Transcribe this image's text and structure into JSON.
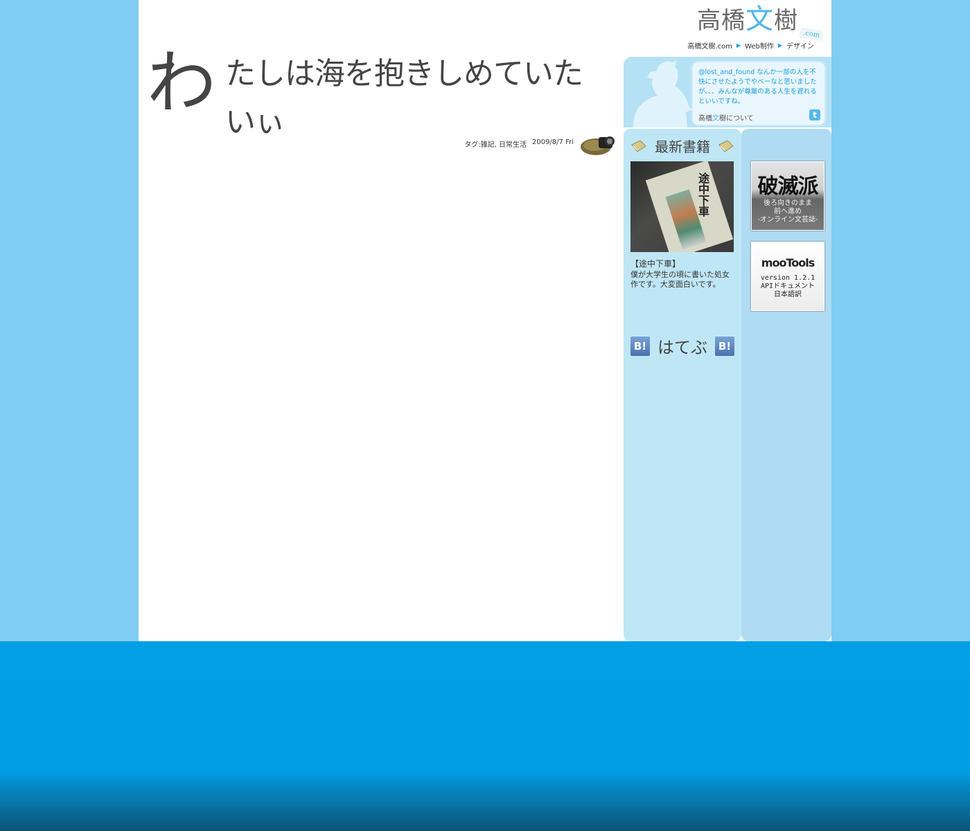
{
  "header": {
    "logo_left": "高橋",
    "logo_accent": "文",
    "logo_right": "樹",
    "logo_tag": ".com",
    "nav": [
      "高橋文樹.com",
      "Web制作",
      "デザイン"
    ]
  },
  "post": {
    "title_first_char": "わ",
    "title_rest": "たしは海を抱きしめていたいぃ",
    "tags_label": "タグ:",
    "tags": "雑記, 日常生活",
    "date": "2009/8/7 Fri"
  },
  "twitter": {
    "handle": "@lost_and_found",
    "text": "なんか一部の人を不快にさせたようでやベーなと思いましたが、、、みんなが尊厳のある人生を遅れるといいですね。",
    "about_prefix": "高橋",
    "about_accent": "文",
    "about_suffix": "樹について",
    "icon": "twitter-icon"
  },
  "latest_books": {
    "heading": "最新書籍",
    "cover_title": "途中下車",
    "book_name": "【途中下車】",
    "description": "僕が大学生の頃に書いた処女作です。大変面白いです。"
  },
  "hatebu": {
    "icon_text": "B!",
    "heading": "はてぶ"
  },
  "banners": {
    "hametsu_title": "破滅派",
    "hametsu_lines": [
      "後ろ向きのまま",
      "前へ進め",
      "-オンライン文芸誌-"
    ],
    "moo_logo": "mooTools",
    "moo_lines": [
      "version 1.2.1",
      "APIドキュメント",
      "日本語訳"
    ]
  },
  "colors": {
    "sky": "#7fcdf2",
    "sea": "#009fe6",
    "accent": "#4fb7e8",
    "text": "#454545"
  }
}
